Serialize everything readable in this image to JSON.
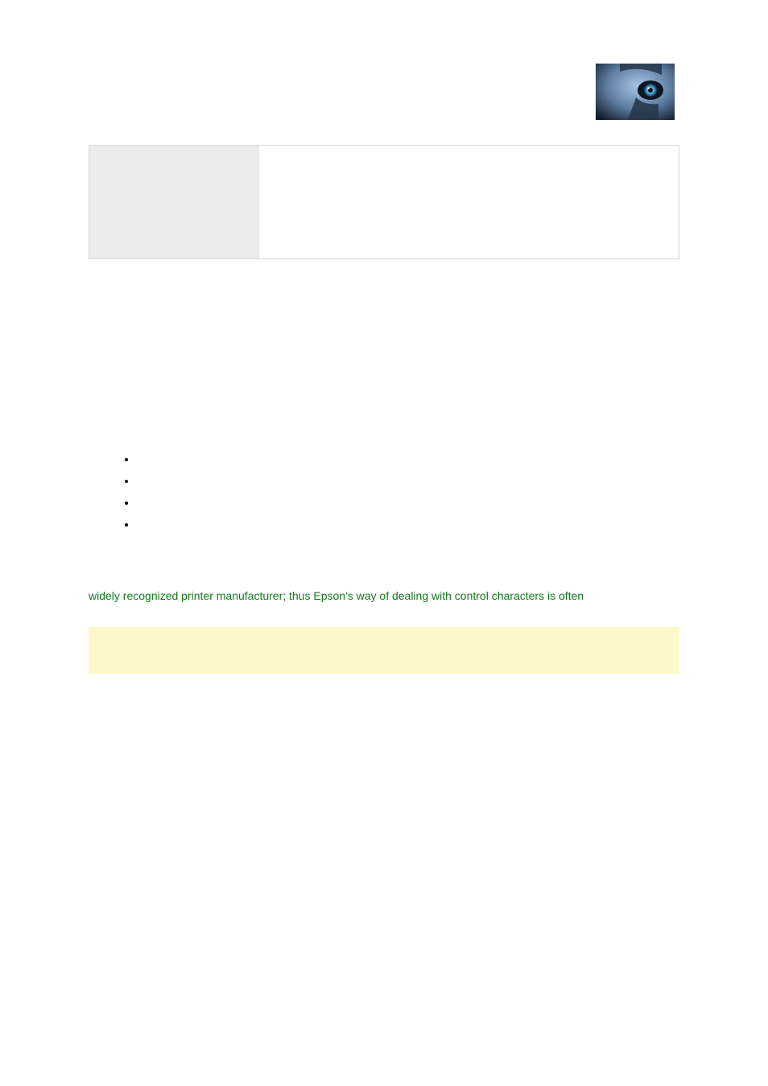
{
  "logo": {
    "name": "wolf-eye"
  },
  "box": {
    "left": "",
    "right": ""
  },
  "bullets": [
    "",
    "",
    "",
    ""
  ],
  "green_paragraph": "widely recognized printer manufacturer; thus Epson's way of dealing with control characters is often",
  "highlight": ""
}
